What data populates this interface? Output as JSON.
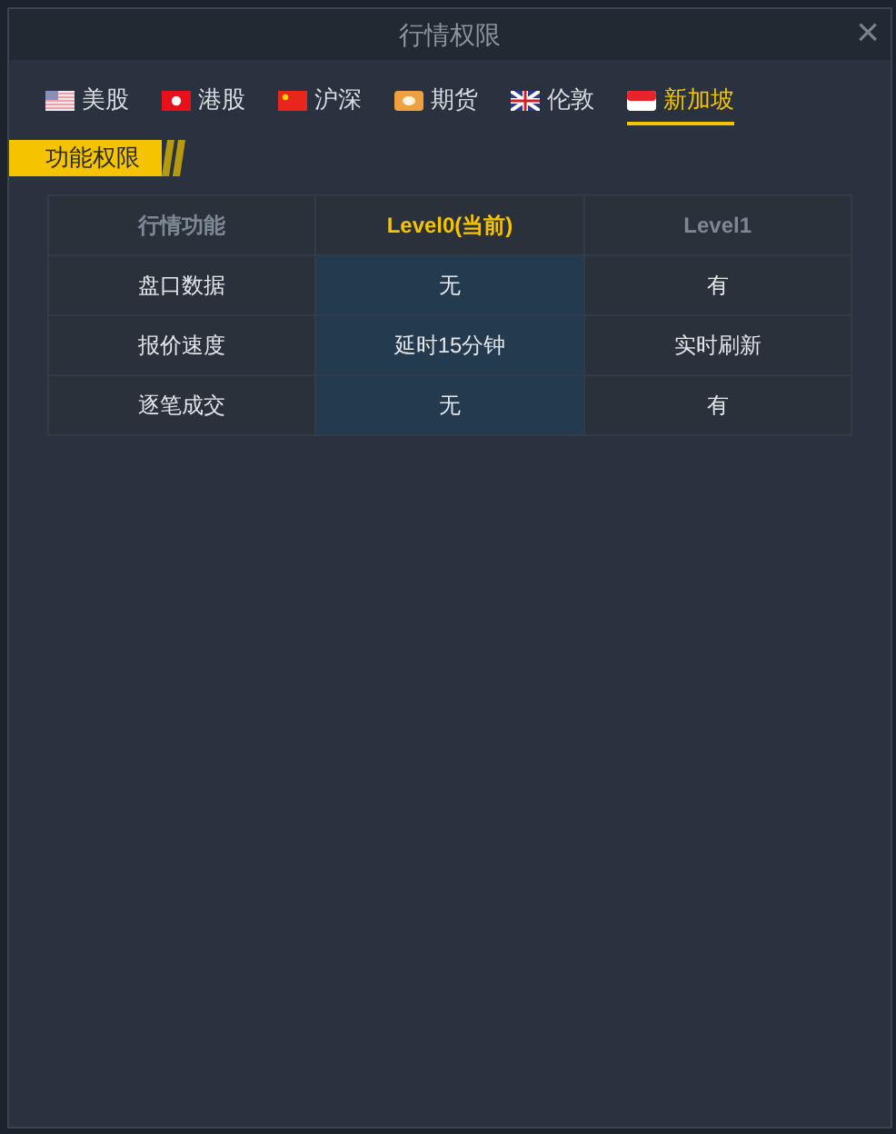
{
  "window": {
    "title": "行情权限",
    "close": "×"
  },
  "tabs": [
    {
      "label": "美股",
      "kind": "us",
      "selected": false
    },
    {
      "label": "港股",
      "kind": "hk",
      "selected": false
    },
    {
      "label": "沪深",
      "kind": "cn",
      "selected": false
    },
    {
      "label": "期货",
      "kind": "futures",
      "selected": false
    },
    {
      "label": "伦敦",
      "kind": "uk",
      "selected": false
    },
    {
      "label": "新加坡",
      "kind": "sg",
      "selected": true
    }
  ],
  "section": {
    "title": "功能权限"
  },
  "table": {
    "columns": [
      {
        "label": "行情功能",
        "selected": false
      },
      {
        "label": "Level0(当前)",
        "selected": true
      },
      {
        "label": "Level1",
        "selected": false
      }
    ],
    "rows": [
      [
        "盘口数据",
        "无",
        "有"
      ],
      [
        "报价速度",
        "延时15分钟",
        "实时刷新"
      ],
      [
        "逐笔成交",
        "无",
        "有"
      ]
    ]
  }
}
